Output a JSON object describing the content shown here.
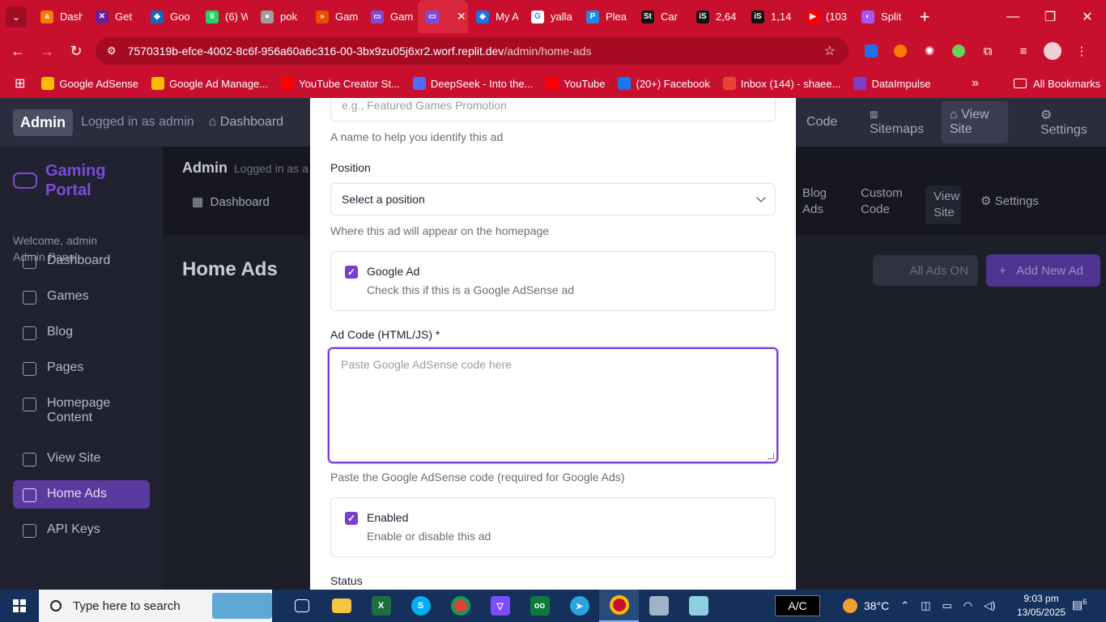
{
  "browser": {
    "tabs": [
      {
        "label": "Dash",
        "color": "#f57c00",
        "glyph": "a"
      },
      {
        "label": "Get",
        "color": "#6a1b9a",
        "glyph": "✕"
      },
      {
        "label": "Goo",
        "color": "#1565c0",
        "glyph": "◆"
      },
      {
        "label": "(6) W",
        "color": "#25d366",
        "glyph": "6"
      },
      {
        "label": "pok",
        "color": "#9e9e9e",
        "glyph": "●"
      },
      {
        "label": "Gam",
        "color": "#e65100",
        "glyph": "»"
      },
      {
        "label": "Gam",
        "color": "#7c4ad8",
        "glyph": "▭"
      },
      {
        "label": "My A",
        "color": "#1a73e8",
        "glyph": "◈"
      },
      {
        "label": "yalla",
        "color": "#ffffff",
        "glyph": "G"
      },
      {
        "label": "Plea",
        "color": "#1e88e5",
        "glyph": "P"
      },
      {
        "label": "Car",
        "color": "#111111",
        "glyph": "St"
      },
      {
        "label": "2,64",
        "color": "#111111",
        "glyph": "iS"
      },
      {
        "label": "1,14",
        "color": "#111111",
        "glyph": "iS"
      },
      {
        "label": "(103",
        "color": "#ff0000",
        "glyph": "▶"
      },
      {
        "label": "Split",
        "color": "#a855f7",
        "glyph": "◐"
      }
    ],
    "url_host": "7570319b-efce-4002-8c6f-956a60a6c316-00-3bx9zu05j6xr2.worf.replit.dev",
    "url_path": "/admin/home-ads",
    "bookmarks": [
      {
        "label": "Google AdSense",
        "color": "#fbbc04"
      },
      {
        "label": "Google Ad Manage...",
        "color": "#fbbc04"
      },
      {
        "label": "YouTube Creator St...",
        "color": "#ff0000"
      },
      {
        "label": "DeepSeek - Into the...",
        "color": "#4d6bfe"
      },
      {
        "label": "YouTube",
        "color": "#ff0000"
      },
      {
        "label": "(20+) Facebook",
        "color": "#1877f2"
      },
      {
        "label": "Inbox (144) - shaee...",
        "color": "#ea4335"
      },
      {
        "label": "DataImpulse",
        "color": "#7b3fd0"
      }
    ],
    "all_bookmarks": "All Bookmarks"
  },
  "topnav": {
    "badge": "Admin",
    "logged": "Logged in as admin",
    "dashboard": "Dashboard",
    "code": "Code",
    "sitemaps": "Sitemaps",
    "view_site": "View Site",
    "settings": "Settings"
  },
  "sidebar": {
    "brand": "Gaming Portal",
    "welcome": "Welcome, admin",
    "role": "Admin Panel",
    "items": [
      {
        "label": "Dashboard"
      },
      {
        "label": "Games"
      },
      {
        "label": "Blog"
      },
      {
        "label": "Pages"
      },
      {
        "label": "Homepage Content"
      },
      {
        "label": "View Site"
      },
      {
        "label": "Home Ads"
      },
      {
        "label": "API Keys"
      }
    ]
  },
  "subheader": {
    "title": "Admin",
    "logged": "Logged in as a",
    "dashboard": "Dashboard",
    "blog_ads": "Blog Ads",
    "custom_code": "Custom Code",
    "view_site": "View Site",
    "settings": "Settings"
  },
  "main": {
    "title": "Home Ads",
    "all_ads": "All Ads ON",
    "add_new": "Add New Ad"
  },
  "modal": {
    "name_placeholder": "e.g., Featured Games Promotion",
    "name_help": "A name to help you identify this ad",
    "position_label": "Position",
    "position_value": "Select a position",
    "position_help": "Where this ad will appear on the homepage",
    "google_ad_title": "Google Ad",
    "google_ad_desc": "Check this if this is a Google AdSense ad",
    "google_ad_checked": true,
    "code_label": "Ad Code (HTML/JS) *",
    "code_placeholder": "Paste Google AdSense code here",
    "code_help": "Paste the Google AdSense code (required for Google Ads)",
    "enabled_title": "Enabled",
    "enabled_desc": "Enable or disable this ad",
    "enabled_checked": true,
    "status_label": "Status"
  },
  "taskbar": {
    "search": "Type here to search",
    "ac": "A/C",
    "temp": "38°C",
    "time": "9:03 pm",
    "date": "13/05/2025",
    "notifications": "6"
  }
}
